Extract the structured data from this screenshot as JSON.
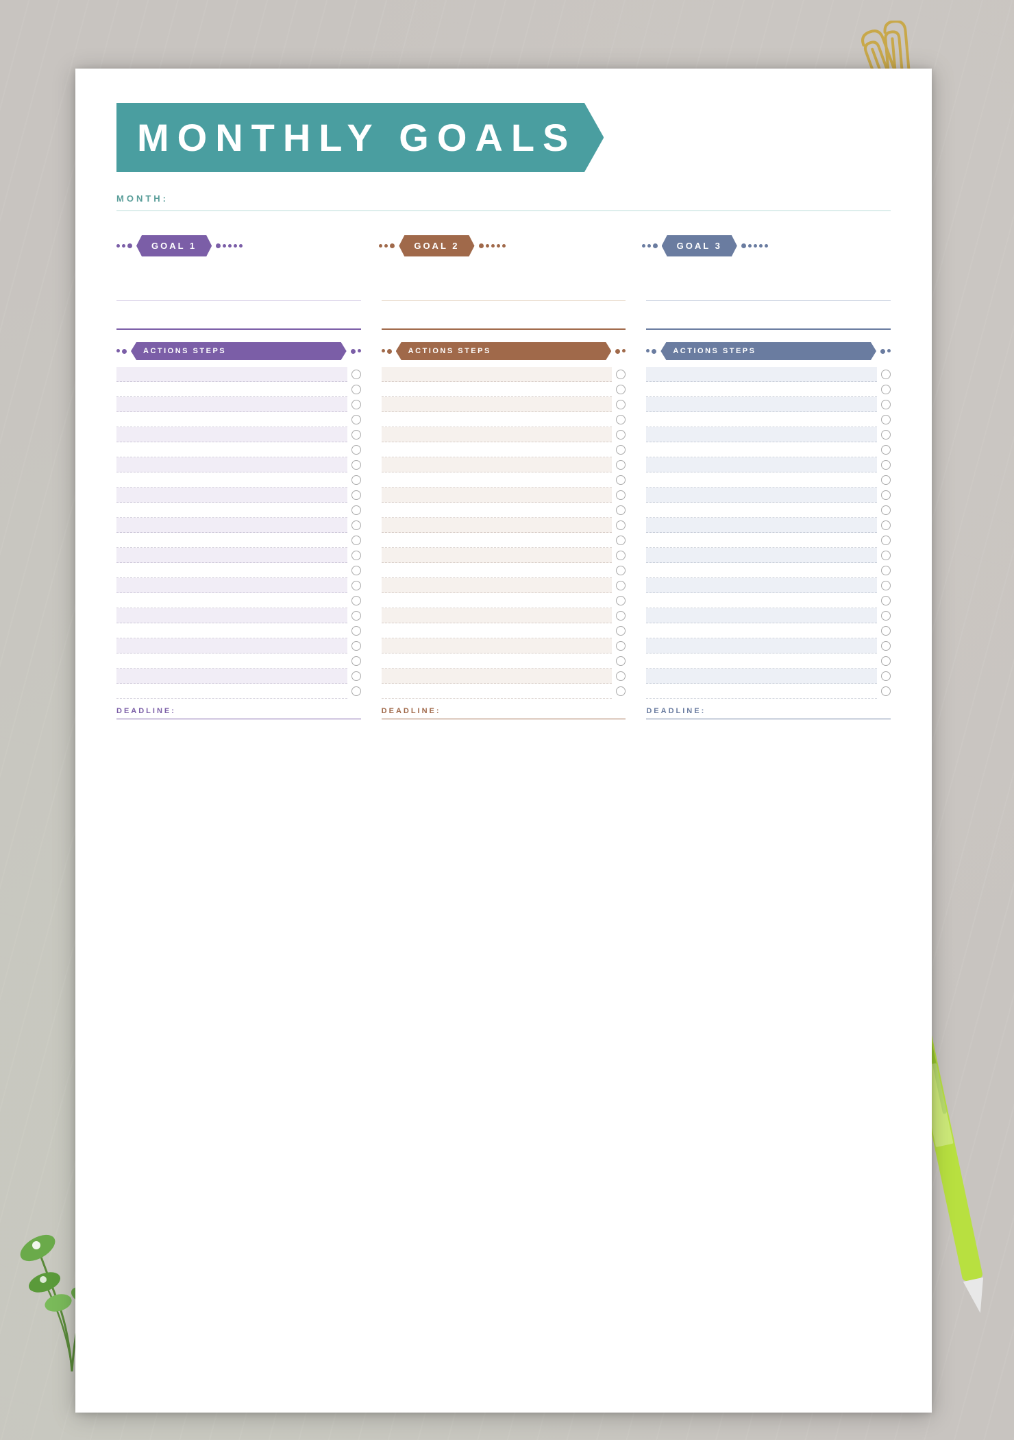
{
  "page": {
    "title": "MONTHLY GOALS",
    "month_label": "MONTH:",
    "goals": [
      {
        "id": "goal1",
        "label": "GOAL 1",
        "color": "purple"
      },
      {
        "id": "goal2",
        "label": "GOAL 2",
        "color": "warm"
      },
      {
        "id": "goal3",
        "label": "GOAL 3",
        "color": "blue"
      }
    ],
    "sections": [
      {
        "id": "col1",
        "header": "ACTIONS STEPS",
        "color": "purple",
        "deadline": "DEADLINE:"
      },
      {
        "id": "col2",
        "header": "ACTIONS STEPS",
        "color": "warm",
        "deadline": "DEADLINE:"
      },
      {
        "id": "col3",
        "header": "ACTIONS STEPS",
        "color": "blue",
        "deadline": "DEADLINE:"
      }
    ],
    "action_rows_count": 22
  }
}
